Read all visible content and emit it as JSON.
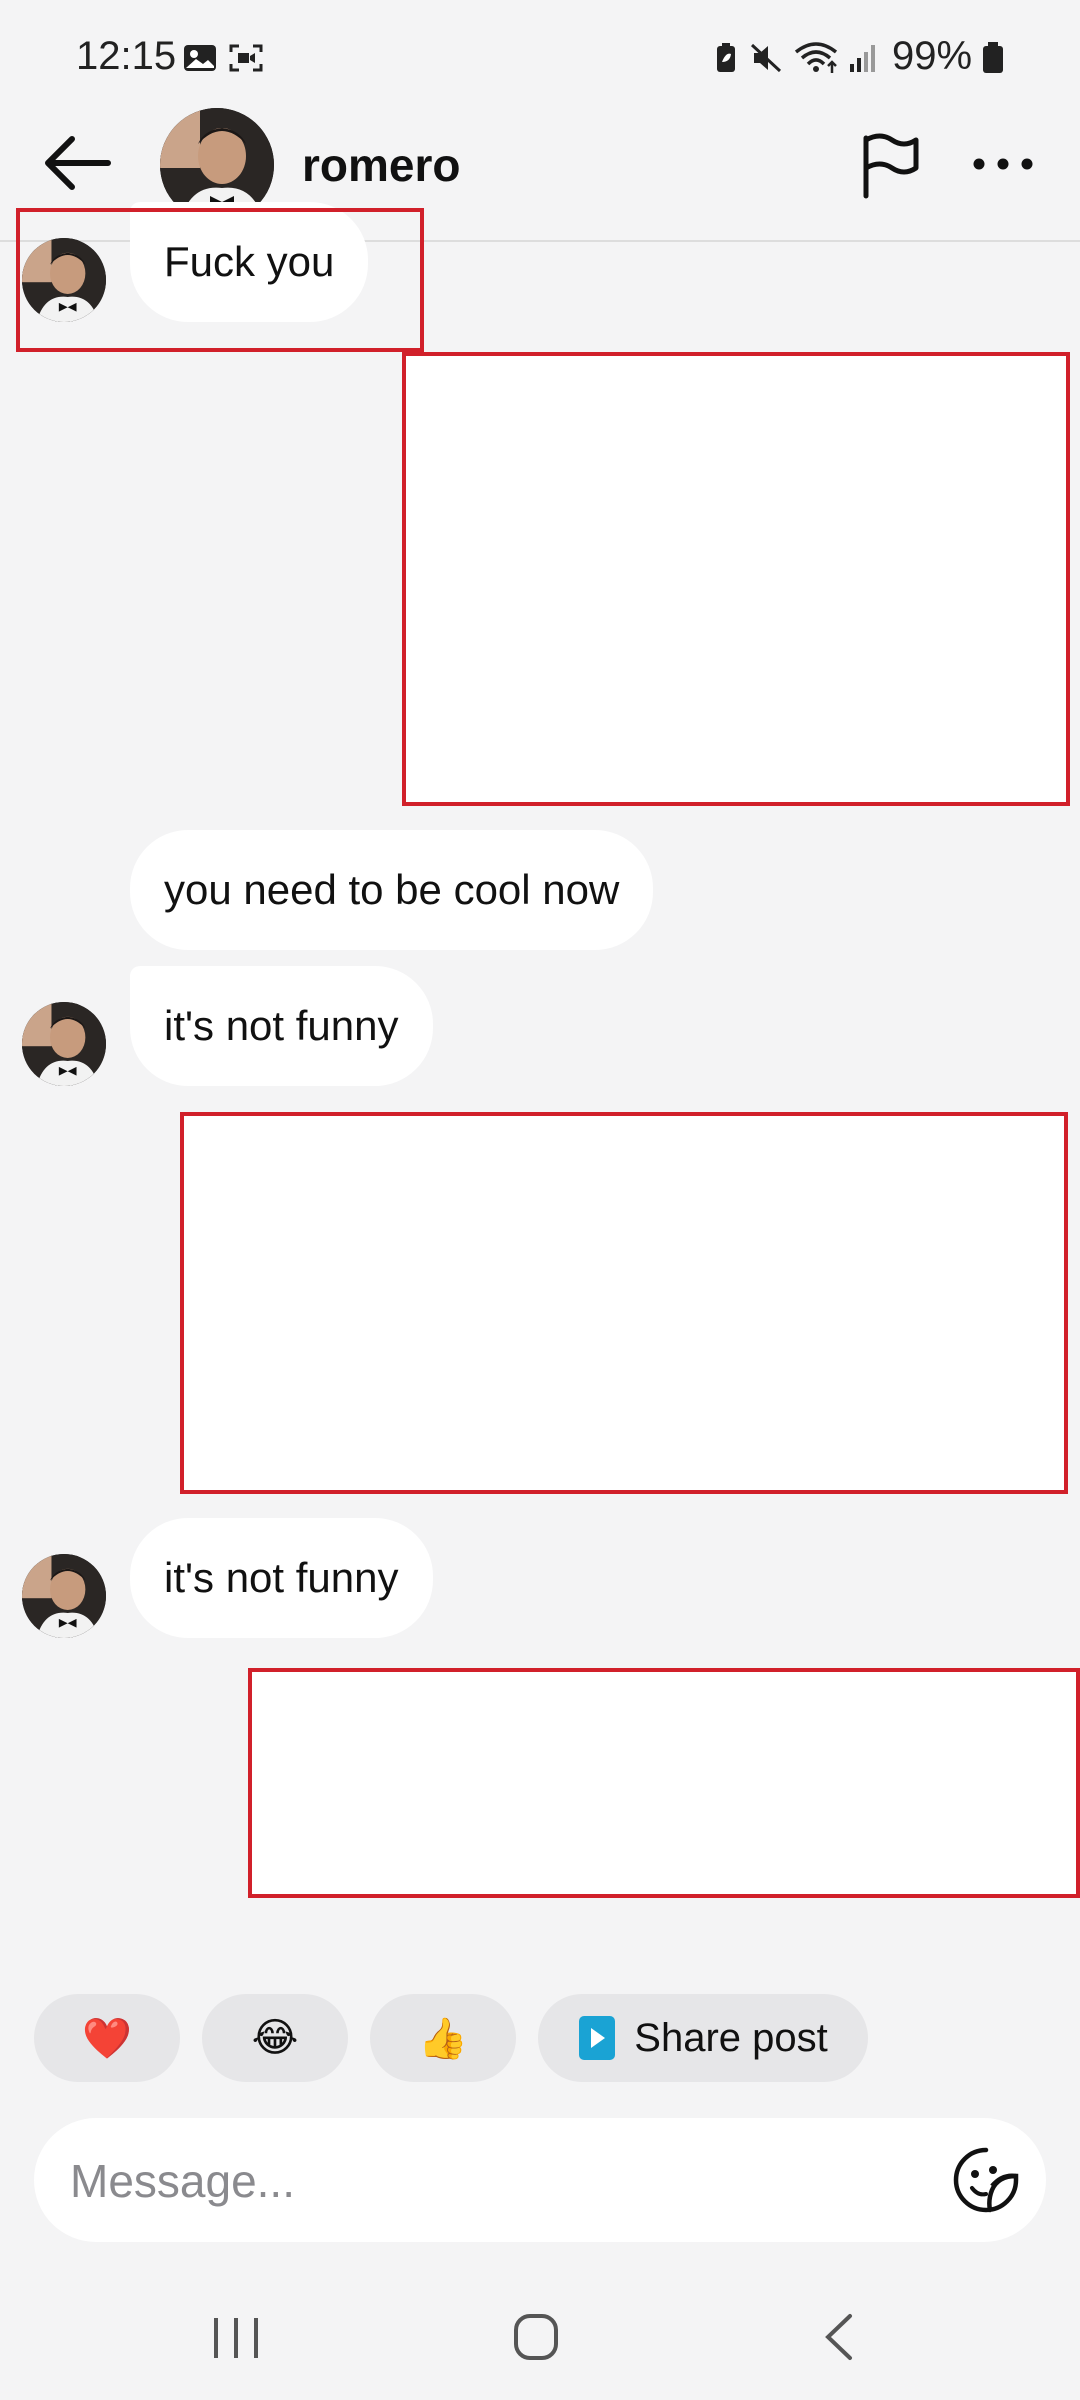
{
  "status_bar": {
    "time": "12:15",
    "battery": "99%",
    "icons": [
      "gallery-icon",
      "screen-record-icon",
      "battery-saver-icon",
      "mute-icon",
      "wifi-icon",
      "signal-icon",
      "battery-icon"
    ]
  },
  "header": {
    "username": "romero",
    "icons": [
      "back-arrow-icon",
      "flag-icon",
      "more-icon"
    ]
  },
  "messages": [
    {
      "side": "incoming",
      "text": "Fuck you",
      "redacted": false
    },
    {
      "side": "outgoing",
      "text": "",
      "redacted": true
    },
    {
      "side": "incoming",
      "text": "you need to be cool now",
      "redacted": false
    },
    {
      "side": "incoming",
      "text": "it's not funny",
      "redacted": false
    },
    {
      "side": "outgoing",
      "text": "",
      "redacted": true
    },
    {
      "side": "incoming",
      "text": "it's not funny",
      "redacted": false
    },
    {
      "side": "outgoing",
      "text": "",
      "redacted": true
    }
  ],
  "quick_reactions": {
    "heart": "❤️",
    "laugh": "😂",
    "thumbs": "👍",
    "share_label": "Share post"
  },
  "composer": {
    "placeholder": "Message..."
  },
  "colors": {
    "background": "#f4f4f5",
    "bubble": "#ffffff",
    "annotation_red": "#d1202a",
    "share_icon": "#1aa3d4"
  }
}
